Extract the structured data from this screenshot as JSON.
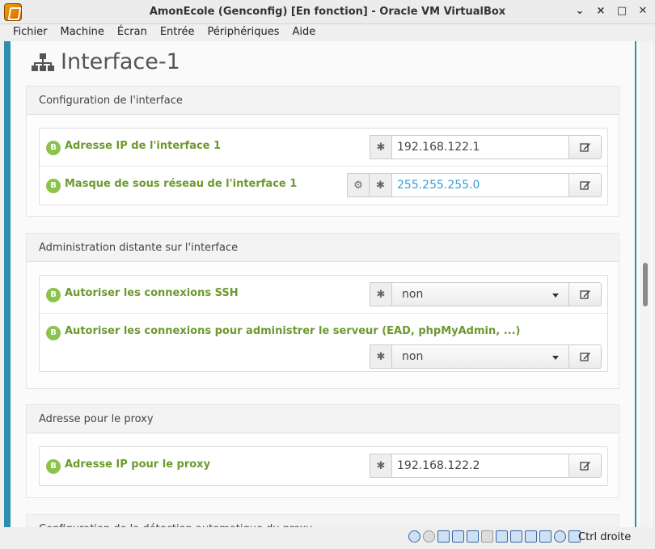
{
  "window": {
    "title": "AmonEcole (Genconfig) [En fonction] - Oracle VM VirtualBox",
    "controls": [
      "⌄",
      "×",
      "□",
      "✕"
    ]
  },
  "menu": [
    "Fichier",
    "Machine",
    "Écran",
    "Entrée",
    "Périphériques",
    "Aide"
  ],
  "page": {
    "title": "Interface-1",
    "icon": "sitemap-icon"
  },
  "sections": [
    {
      "title": "Configuration de l'interface",
      "rows": [
        {
          "badge": "B",
          "label": "Adresse IP de l'interface 1",
          "value": "192.168.122.1",
          "type": "input"
        },
        {
          "badge": "B",
          "label": "Masque de sous réseau de l'interface 1",
          "value": "255.255.255.0",
          "type": "input"
        }
      ]
    },
    {
      "title": "Administration distante sur l'interface",
      "rows": [
        {
          "badge": "B",
          "label": "Autoriser les connexions SSH",
          "value": "non",
          "type": "select"
        },
        {
          "badge": "B",
          "label": "Autoriser les connexions pour administrer le serveur (EAD, phpMyAdmin, ...)",
          "value": "non",
          "type": "select"
        }
      ]
    },
    {
      "title": "Adresse pour le proxy",
      "rows": [
        {
          "badge": "B",
          "label": "Adresse IP pour le proxy",
          "value": "192.168.122.2",
          "type": "input"
        }
      ]
    },
    {
      "title": "Configuration de la détection automatique du proxy"
    }
  ],
  "statusbar": {
    "host_key": "Ctrl droite"
  },
  "colors": {
    "accent_bar": "#2f8eae",
    "label_green": "#6c9a2e",
    "badge_green": "#8cc34d",
    "highlight_blue": "#3a9bd5"
  }
}
